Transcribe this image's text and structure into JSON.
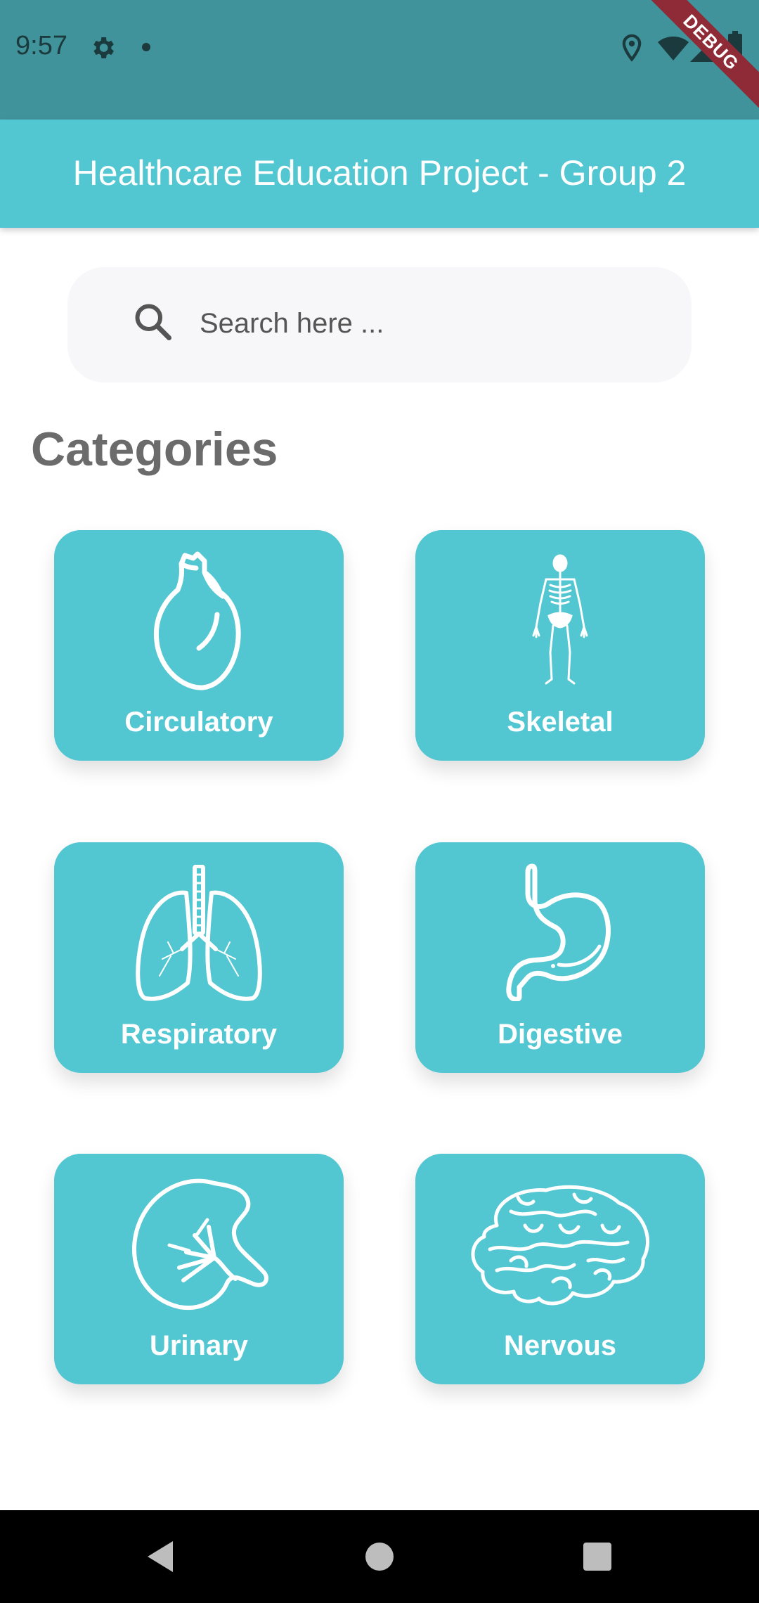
{
  "status_bar": {
    "time": "9:57",
    "icons": [
      "gear-icon",
      "notification-dot-icon",
      "location-icon",
      "wifi-icon",
      "signal-icon",
      "battery-icon"
    ],
    "debug_label": "DEBUG",
    "background": "#41939b"
  },
  "app_bar": {
    "title": "Healthcare Education Project - Group 2",
    "background": "#52c6d1"
  },
  "search": {
    "placeholder": "Search here ...",
    "value": "",
    "icon": "search-icon"
  },
  "section": {
    "title": "Categories"
  },
  "categories": [
    {
      "label": "Circulatory",
      "icon": "heart-icon"
    },
    {
      "label": "Skeletal",
      "icon": "skeleton-icon"
    },
    {
      "label": "Respiratory",
      "icon": "lungs-icon"
    },
    {
      "label": "Digestive",
      "icon": "stomach-icon"
    },
    {
      "label": "Urinary",
      "icon": "kidney-icon"
    },
    {
      "label": "Nervous",
      "icon": "brain-icon"
    }
  ],
  "colors": {
    "accent": "#52c6d1",
    "status_bar": "#41939b",
    "heading": "#6b6b6b",
    "search_bg": "#f7f7f9"
  },
  "nav_bar": {
    "buttons": [
      "back-icon",
      "home-icon",
      "recents-icon"
    ]
  }
}
